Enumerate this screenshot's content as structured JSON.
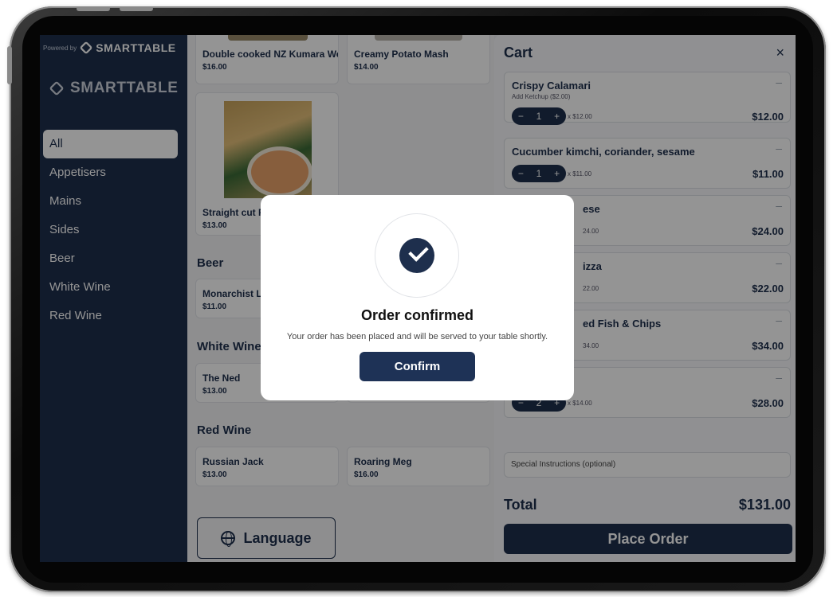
{
  "sidebar": {
    "powered_by": "Powered by",
    "brand": "SMARTTABLE",
    "items": [
      {
        "label": "All"
      },
      {
        "label": "Appetisers"
      },
      {
        "label": "Mains"
      },
      {
        "label": "Sides"
      },
      {
        "label": "Beer"
      },
      {
        "label": "White Wine"
      },
      {
        "label": "Red Wine"
      }
    ]
  },
  "menu": {
    "sides": [
      {
        "name": "Double cooked NZ Kumara We",
        "price": "$16.00"
      },
      {
        "name": "Creamy Potato Mash",
        "price": "$14.00"
      },
      {
        "name": "Straight cut F",
        "price": "$13.00"
      }
    ],
    "beer_title": "Beer",
    "beer": [
      {
        "name": "Monarchist L",
        "price": "$11.00"
      }
    ],
    "white_title": "White Wine",
    "white": [
      {
        "name": "The Ned",
        "price": "$13.00"
      }
    ],
    "red_title": "Red Wine",
    "red": [
      {
        "name": "Russian Jack",
        "price": "$13.00"
      },
      {
        "name": "Roaring Meg",
        "price": "$16.00"
      }
    ],
    "language_label": "Language"
  },
  "cart": {
    "title": "Cart",
    "close": "×",
    "items": [
      {
        "name": "Crispy Calamari",
        "option": "Add Ketchup ($2.00)",
        "qty": "1",
        "unit": "x $12.00",
        "price": "$12.00"
      },
      {
        "name": "Cucumber kimchi, coriander, sesame",
        "qty": "1",
        "unit": "x $11.00",
        "price": "$11.00"
      },
      {
        "name": "ese",
        "unit": "24.00",
        "price": "$24.00"
      },
      {
        "name": "izza",
        "unit": "22.00",
        "price": "$22.00"
      },
      {
        "name": "ed Fish & Chips",
        "unit": "34.00",
        "price": "$34.00"
      },
      {
        "qty": "2",
        "unit": "x $14.00",
        "price": "$28.00"
      }
    ],
    "remove": "–",
    "minus": "−",
    "plus": "+",
    "special_placeholder": "Special Instructions (optional)",
    "total_label": "Total",
    "total_value": "$131.00",
    "place_order": "Place Order"
  },
  "modal": {
    "title": "Order confirmed",
    "body": "Your order has been placed and will be served to your table shortly.",
    "confirm": "Confirm"
  },
  "colors": {
    "brand_navy": "#1e2f4d"
  }
}
